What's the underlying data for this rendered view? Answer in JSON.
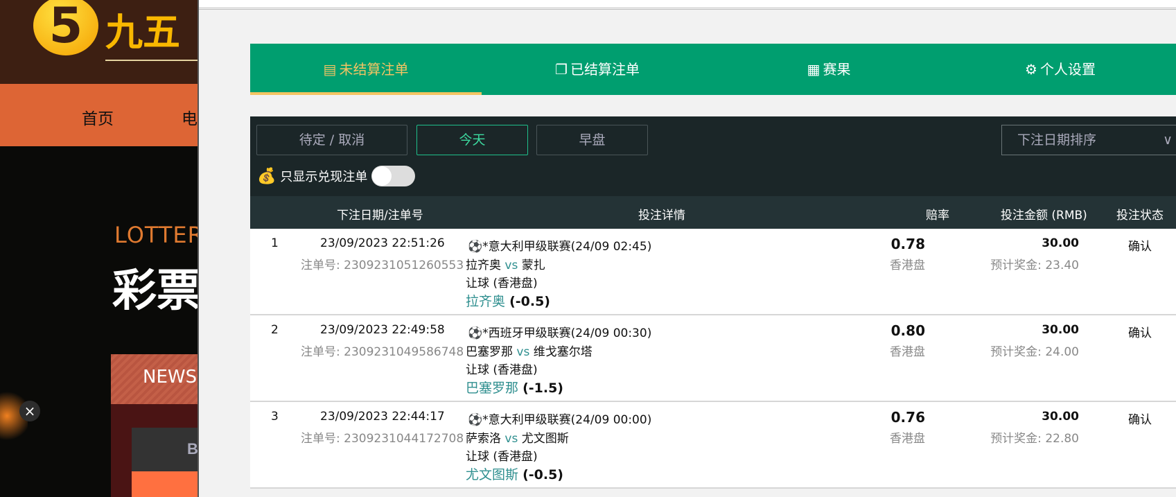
{
  "background_site": {
    "logo_text": "九五",
    "nav": [
      "首页",
      "电"
    ],
    "banner_label": "LOTTER",
    "banner_title": "彩票",
    "news_label": "NEWS",
    "box_label": "B",
    "close_label": "×"
  },
  "tabs": [
    {
      "label": "未结算注单",
      "icon": "ledger-icon",
      "active": true
    },
    {
      "label": "已结算注单",
      "icon": "settled-icon",
      "active": false
    },
    {
      "label": "赛果",
      "icon": "results-icon",
      "active": false
    },
    {
      "label": "个人设置",
      "icon": "gear-icon",
      "active": false
    }
  ],
  "filters": {
    "buttons": [
      {
        "label": "待定 / 取消",
        "active": false
      },
      {
        "label": "今天",
        "active": true
      },
      {
        "label": "早盘",
        "active": false
      }
    ],
    "sort_select": "下注日期排序",
    "cashout_toggle_label": "只显示兑现注单",
    "cashout_toggle_on": false
  },
  "columns": [
    "下注日期/注单号",
    "投注详情",
    "赔率",
    "投注金额 (RMB)",
    "投注状态"
  ],
  "rows": [
    {
      "idx": "1",
      "datetime": "23/09/2023 22:51:26",
      "ticket": "注单号: 2309231051260553",
      "league": "*意大利甲级联赛(24/09 02:45)",
      "home": "拉齐奥",
      "vs": "vs",
      "away": "蒙扎",
      "market": "让球 (香港盘)",
      "pick": "拉齐奥",
      "line": "(-0.5)",
      "odds": "0.78",
      "odds_type": "香港盘",
      "stake": "30.00",
      "payout": "预计奖金: 23.40",
      "status": "确认"
    },
    {
      "idx": "2",
      "datetime": "23/09/2023 22:49:58",
      "ticket": "注单号: 2309231049586748",
      "league": "*西班牙甲级联赛(24/09 00:30)",
      "home": "巴塞罗那",
      "vs": "vs",
      "away": "维戈塞尔塔",
      "market": "让球 (香港盘)",
      "pick": "巴塞罗那",
      "line": "(-1.5)",
      "odds": "0.80",
      "odds_type": "香港盘",
      "stake": "30.00",
      "payout": "预计奖金: 24.00",
      "status": "确认"
    },
    {
      "idx": "3",
      "datetime": "23/09/2023 22:44:17",
      "ticket": "注单号: 2309231044172708",
      "league": "*意大利甲级联赛(24/09 00:00)",
      "home": "萨索洛",
      "vs": "vs",
      "away": "尤文图斯",
      "market": "让球 (香港盘)",
      "pick": "尤文图斯",
      "line": "(-0.5)",
      "odds": "0.76",
      "odds_type": "香港盘",
      "stake": "30.00",
      "payout": "预计奖金: 22.80",
      "status": "确认"
    }
  ]
}
